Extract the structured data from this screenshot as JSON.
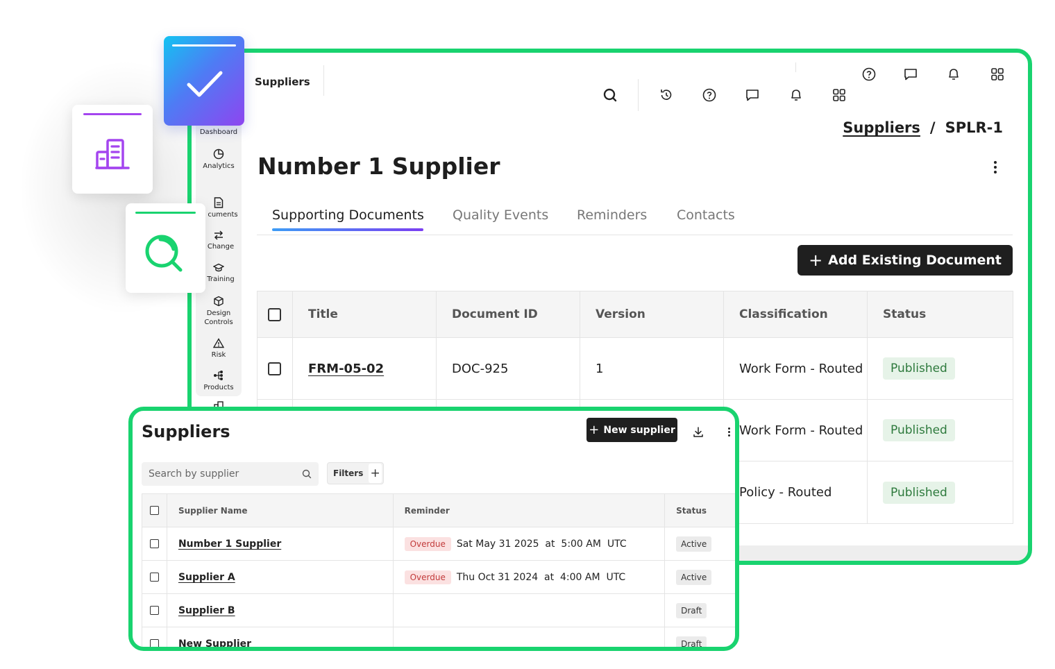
{
  "main": {
    "app_title": "Suppliers",
    "breadcrumb": {
      "parent": "Suppliers",
      "separator": "/",
      "current": "SPLR-1"
    },
    "page_title": "Number 1 Supplier",
    "tabs": [
      {
        "label": "Supporting Documents",
        "active": true
      },
      {
        "label": "Quality Events",
        "active": false
      },
      {
        "label": "Reminders",
        "active": false
      },
      {
        "label": "Contacts",
        "active": false
      }
    ],
    "add_button": {
      "icon": "+",
      "label": "Add Existing Document"
    },
    "nav": [
      {
        "label": "Dashboard",
        "icon": "dashboard-icon"
      },
      {
        "label": "Analytics",
        "icon": "pie-chart-icon"
      },
      {
        "label": "cuments",
        "icon": "document-icon"
      },
      {
        "label": "Change",
        "icon": "change-arrows-icon"
      },
      {
        "label": "Training",
        "icon": "graduation-cap-icon"
      },
      {
        "label": "Design",
        "label2": "Controls",
        "icon": "cube-icon"
      },
      {
        "label": "Risk",
        "icon": "warning-icon"
      },
      {
        "label": "Products",
        "icon": "hierarchy-icon"
      }
    ],
    "table": {
      "headers": [
        "Title",
        "Document ID",
        "Version",
        "Classification",
        "Status"
      ],
      "rows": [
        {
          "title": "FRM-05-02",
          "doc_id": "DOC-925",
          "version": "1",
          "classification": "Work Form - Routed",
          "status": "Published"
        },
        {
          "title": "",
          "doc_id": "",
          "version": "",
          "classification": "Work Form - Routed",
          "status": "Published"
        },
        {
          "title": "",
          "doc_id": "",
          "version": "",
          "classification": "Policy - Routed",
          "status": "Published"
        }
      ]
    }
  },
  "suppliers_panel": {
    "title": "Suppliers",
    "new_button": {
      "icon": "+",
      "label": "New supplier"
    },
    "search_placeholder": "Search by supplier",
    "filters_label": "Filters",
    "filters_plus": "+",
    "headers": [
      "Supplier Name",
      "Reminder",
      "Status"
    ],
    "rows": [
      {
        "name": "Number 1 Supplier",
        "badge": "Overdue",
        "reminder": "Sat May 31 2025  at  5:00 AM  UTC",
        "status": "Active"
      },
      {
        "name": "Supplier A",
        "badge": "Overdue",
        "reminder": "Thu Oct 31 2024  at  4:00 AM  UTC",
        "status": "Active"
      },
      {
        "name": "Supplier B",
        "badge": "",
        "reminder": "",
        "status": "Draft"
      },
      {
        "name": "New Supplier",
        "badge": "",
        "reminder": "",
        "status": "Draft"
      }
    ]
  },
  "colors": {
    "frame_green": "#19d36f",
    "tab_gradient_start": "#3d9cf5",
    "tab_gradient_end": "#7b3ff2",
    "buildings_purple": "#a445ef",
    "search_green": "#19d36f",
    "published_bg": "#e6f3e8",
    "overdue_bg": "#fbe1e1"
  }
}
